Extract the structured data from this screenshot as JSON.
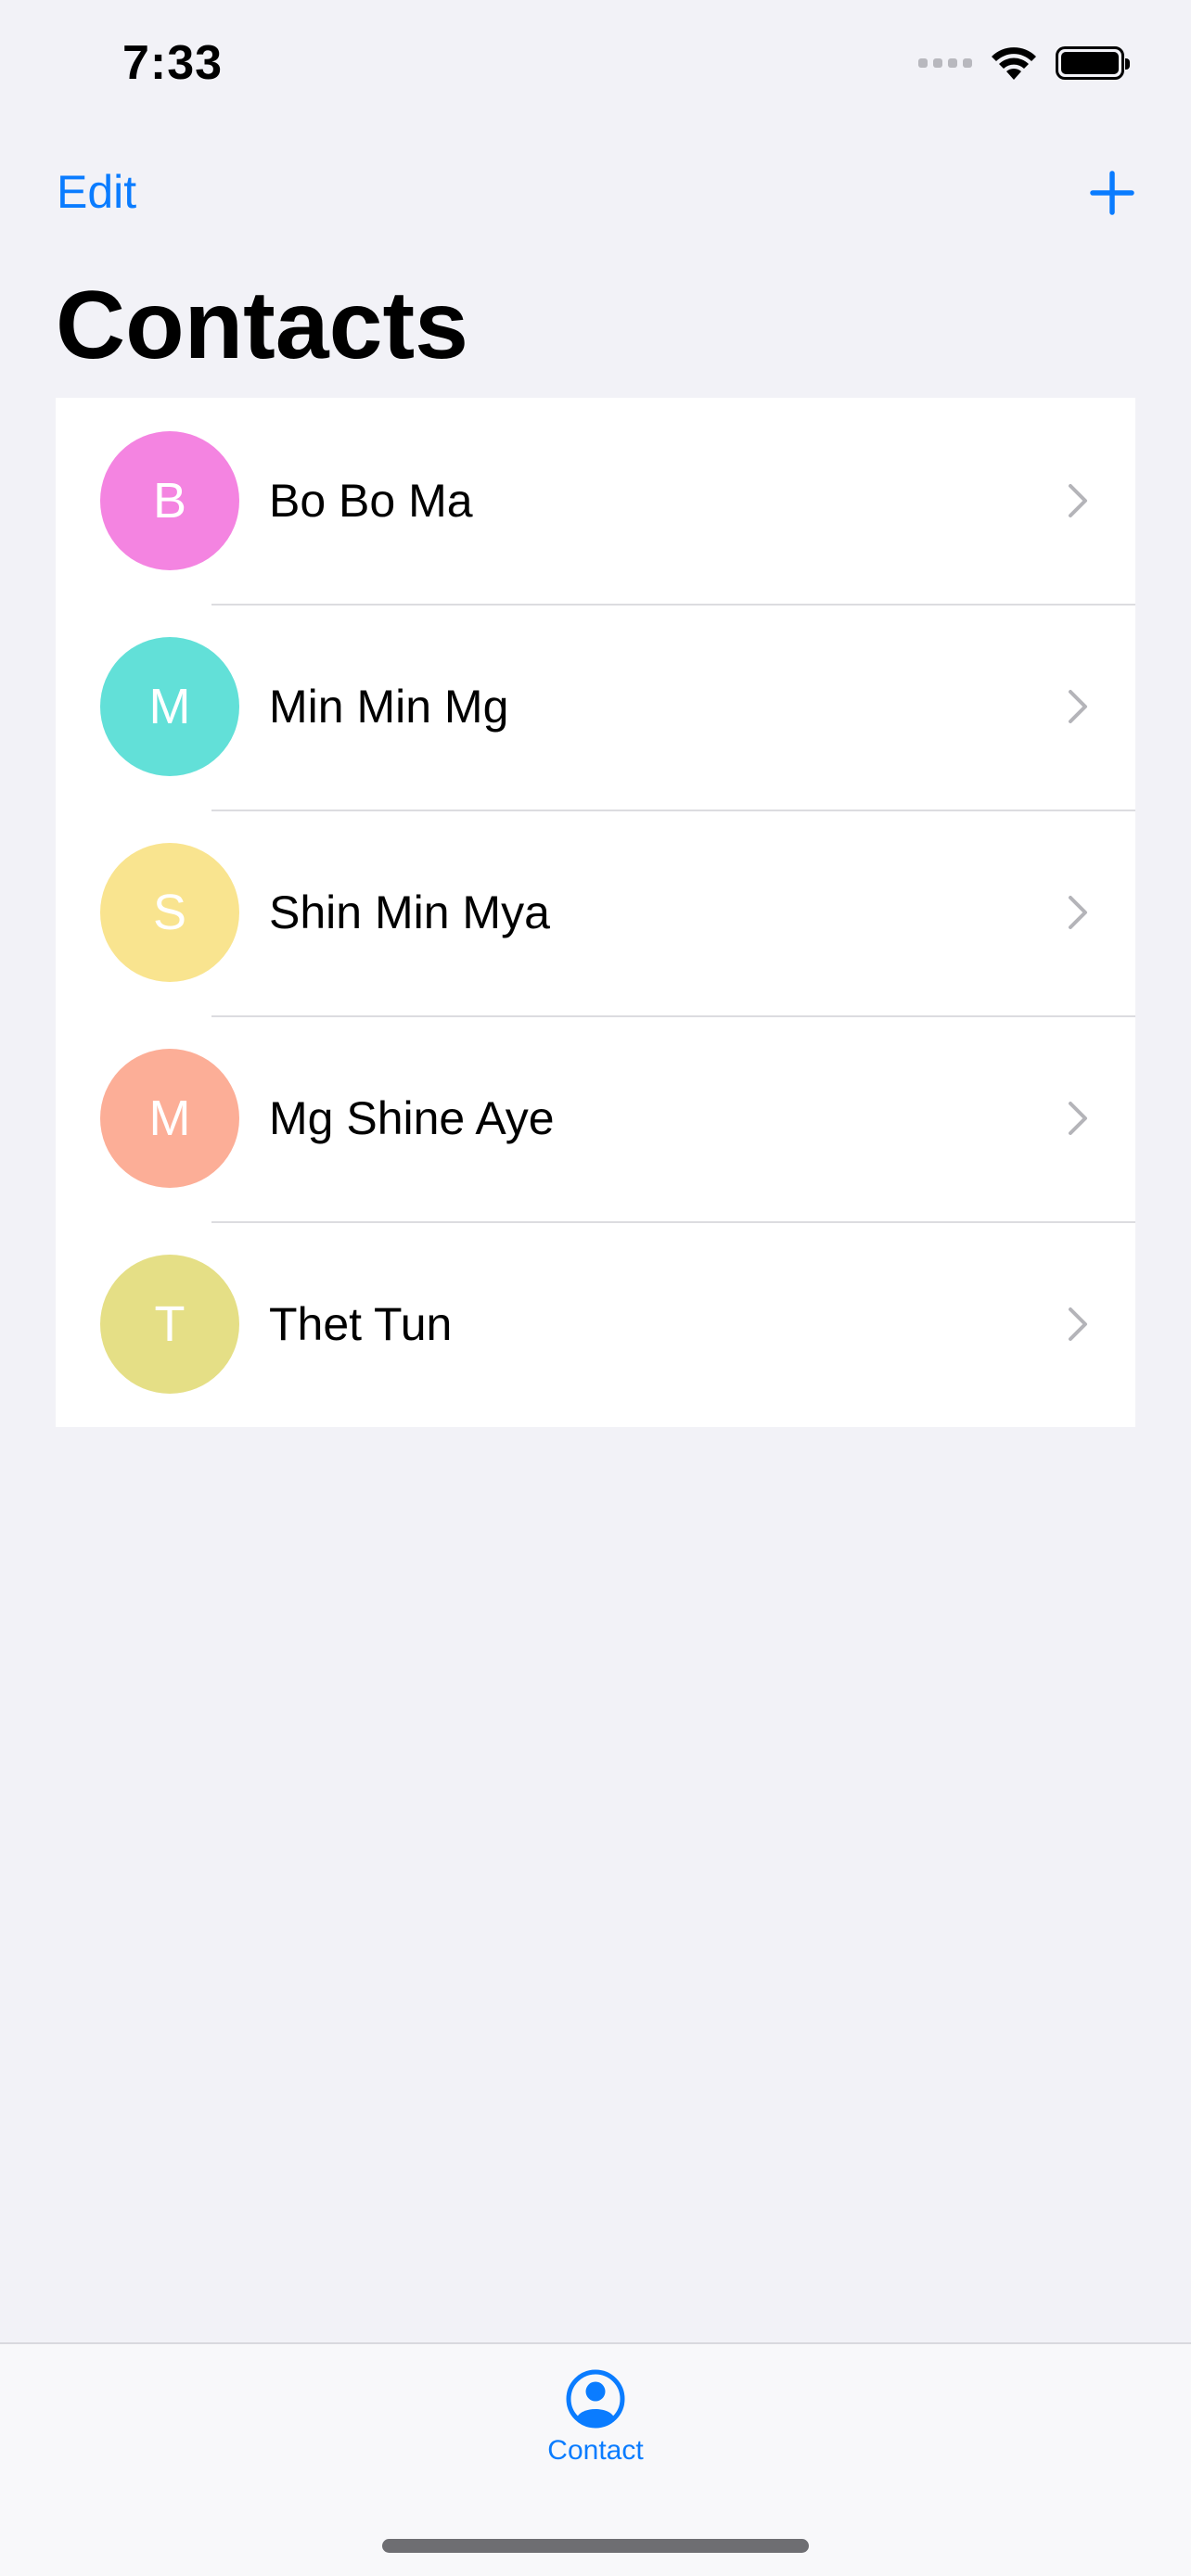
{
  "status_bar": {
    "time": "7:33",
    "icons": [
      "signal-dots-icon",
      "wifi-icon",
      "battery-icon"
    ]
  },
  "nav": {
    "edit_label": "Edit",
    "add_icon": "plus-icon"
  },
  "page": {
    "title": "Contacts"
  },
  "contacts": [
    {
      "initial": "B",
      "name": "Bo Bo Ma",
      "color": "#f484e1"
    },
    {
      "initial": "M",
      "name": "Min Min Mg",
      "color": "#62e0d8"
    },
    {
      "initial": "S",
      "name": "Shin Min Mya",
      "color": "#f9e48f"
    },
    {
      "initial": "M",
      "name": "Mg Shine Aye",
      "color": "#fcae97"
    },
    {
      "initial": "T",
      "name": "Thet Tun",
      "color": "#e5df86"
    }
  ],
  "tab_bar": {
    "tabs": [
      {
        "label": "Contact",
        "icon": "person-circle-icon",
        "selected": true
      }
    ]
  },
  "colors": {
    "accent": "#0a7cff",
    "background": "#f2f2f7"
  }
}
